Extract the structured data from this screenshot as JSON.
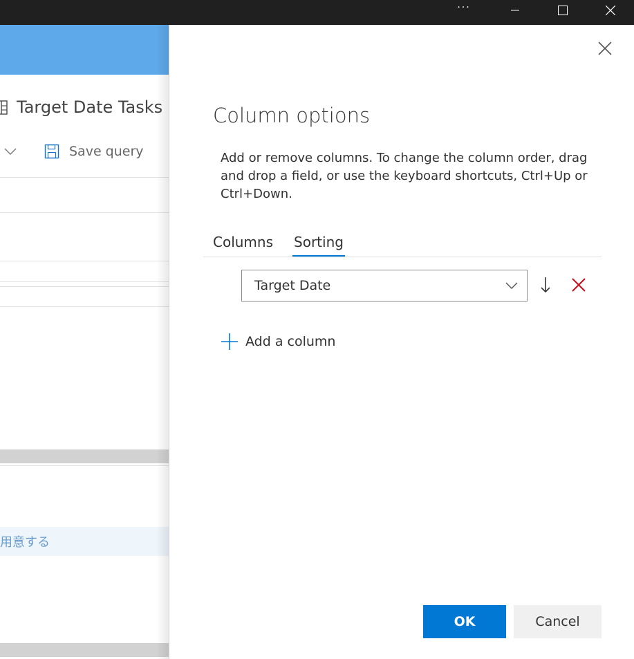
{
  "window": {
    "more_label": "···",
    "controls": [
      "minimize-icon",
      "maximize-icon",
      "close-icon"
    ]
  },
  "background_page": {
    "query_title": "Target Date Tasks",
    "toolbar": {
      "save_query_label": "Save query"
    },
    "link_text": "用意する"
  },
  "panel": {
    "title": "Column options",
    "description": "Add or remove columns. To change the column order, drag and drop a field, or use the keyboard shortcuts, Ctrl+Up or Ctrl+Down.",
    "tabs": [
      {
        "label": "Columns",
        "active": false
      },
      {
        "label": "Sorting",
        "active": true
      }
    ],
    "sort_field": {
      "value": "Target Date",
      "direction": "descending"
    },
    "add_column_label": "Add a column",
    "ok_label": "OK",
    "cancel_label": "Cancel"
  },
  "colors": {
    "accent": "#0078d4",
    "remove": "#c50f1f",
    "banner": "#5ea9e9",
    "titlebar": "#202020"
  }
}
